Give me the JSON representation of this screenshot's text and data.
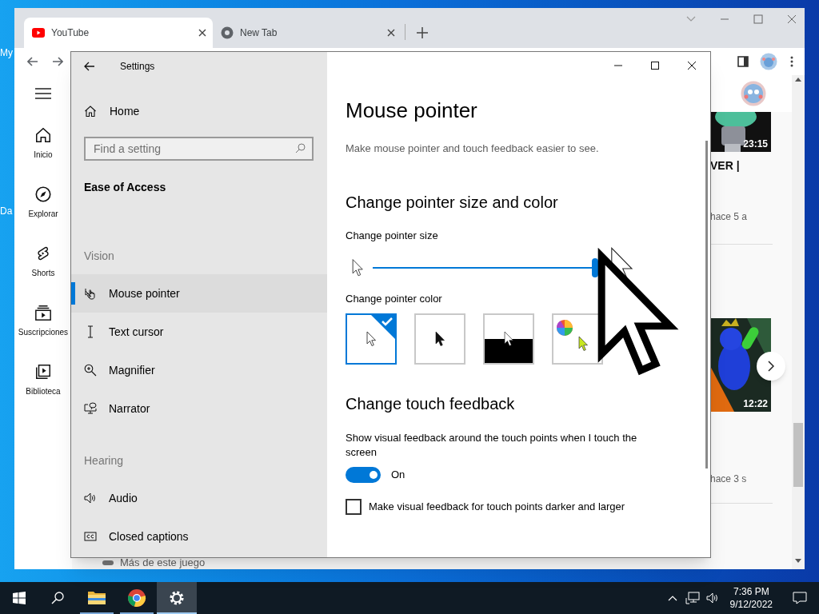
{
  "desktop": {
    "icon_labels": [
      "My",
      "Da"
    ]
  },
  "browser": {
    "tabs": [
      {
        "label": "YouTube",
        "selected": true
      },
      {
        "label": "New Tab",
        "selected": false
      }
    ],
    "youtube": {
      "sidebar": [
        {
          "label": "Inicio"
        },
        {
          "label": "Explorar"
        },
        {
          "label": "Shorts"
        },
        {
          "label": "Suscripciones"
        },
        {
          "label": "Biblioteca"
        }
      ],
      "videos": [
        {
          "duration": "23:15",
          "title": "VER |",
          "meta": "hace 5 a"
        },
        {
          "duration": "12:22",
          "meta": "hace 3 s"
        }
      ],
      "footer_item": "Más de este juego"
    }
  },
  "settings": {
    "title": "Settings",
    "home": "Home",
    "search": {
      "placeholder": "Find a setting"
    },
    "category": "Ease of Access",
    "groups": [
      {
        "heading": "Vision",
        "items": [
          {
            "label": "Mouse pointer",
            "selected": true
          },
          {
            "label": "Text cursor",
            "selected": false
          },
          {
            "label": "Magnifier",
            "selected": false
          },
          {
            "label": "Narrator",
            "selected": false
          }
        ]
      },
      {
        "heading": "Hearing",
        "items": [
          {
            "label": "Audio",
            "selected": false
          },
          {
            "label": "Closed captions",
            "selected": false
          }
        ]
      }
    ],
    "page": {
      "title": "Mouse pointer",
      "description": "Make mouse pointer and touch feedback easier to see.",
      "size_color_heading": "Change pointer size and color",
      "size_label": "Change pointer size",
      "size_slider": {
        "level": 1
      },
      "color_label": "Change pointer color",
      "colors": [
        {
          "kind": "white",
          "selected": true
        },
        {
          "kind": "black",
          "selected": false
        },
        {
          "kind": "inverted",
          "selected": false
        },
        {
          "kind": "custom",
          "selected": false
        }
      ],
      "touch_heading": "Change touch feedback",
      "touch_toggle": {
        "label": "Show visual feedback around the touch points when I touch the screen",
        "on": true,
        "state_text": "On"
      },
      "darker_checkbox": {
        "label": "Make visual feedback for touch points darker and larger",
        "checked": false
      }
    }
  },
  "taskbar": {
    "apps": [
      {
        "kind": "explorer",
        "selected": false
      },
      {
        "kind": "chrome",
        "selected": false
      },
      {
        "kind": "settings",
        "selected": true
      }
    ],
    "time": "7:36 PM",
    "date": "9/12/2022"
  }
}
